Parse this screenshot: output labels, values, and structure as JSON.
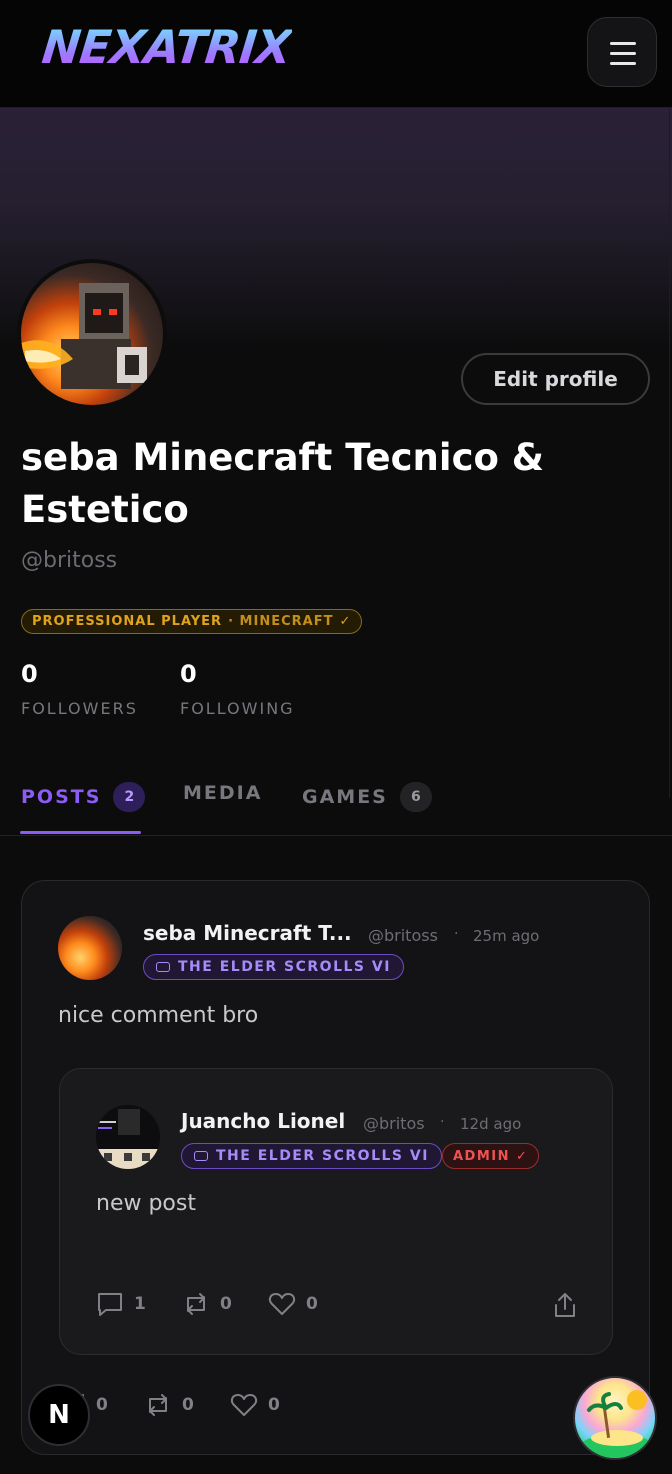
{
  "app": {
    "logo_text": "NEXATRIX"
  },
  "profile": {
    "display_name": "seba Minecraft Tecnico & Estetico",
    "handle": "@britoss",
    "edit_label": "Edit profile",
    "role_badge": "PROFESSIONAL PLAYER",
    "role_game": "· MINECRAFT",
    "role_check": "✓",
    "followers_count": "0",
    "followers_label": "FOLLOWERS",
    "following_count": "0",
    "following_label": "FOLLOWING"
  },
  "tabs": [
    {
      "label": "POSTS",
      "count": "2",
      "active": true
    },
    {
      "label": "MEDIA",
      "count": "",
      "active": false
    },
    {
      "label": "GAMES",
      "count": "6",
      "active": false
    }
  ],
  "post": {
    "author": "seba Minecraft T...",
    "handle": "@britoss",
    "separator": "·",
    "time": "25m ago",
    "game": "THE ELDER SCROLLS VI",
    "text": "nice comment bro",
    "comments": "0",
    "reposts": "0",
    "likes": "0",
    "quoted": {
      "author": "Juancho Lionel",
      "handle": "@britos",
      "separator": "·",
      "time": "12d ago",
      "game": "THE ELDER SCROLLS VI",
      "admin": "ADMIN",
      "admin_check": "✓",
      "text": "new post",
      "comments": "1",
      "reposts": "0",
      "likes": "0"
    }
  },
  "fab": {
    "n_label": "N"
  },
  "colors": {
    "accent": "#8b5cf6",
    "gold": "#e0a31e",
    "admin_red": "#f05252",
    "background": "#0c0c0d"
  }
}
